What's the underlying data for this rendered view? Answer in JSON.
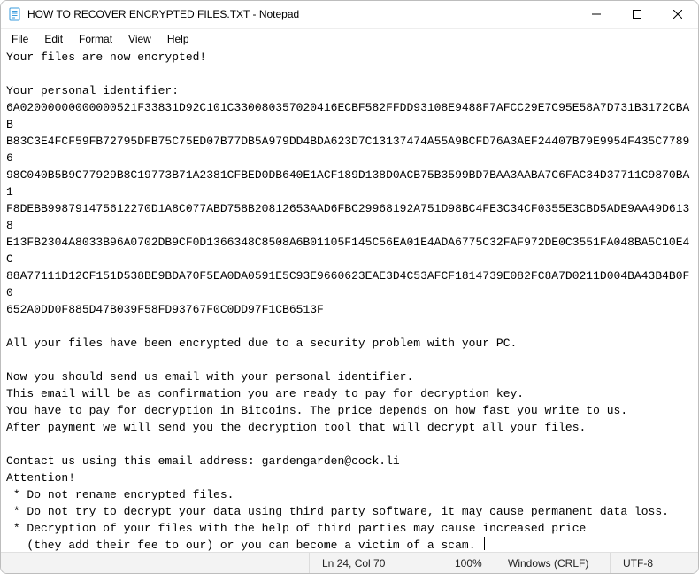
{
  "window": {
    "title": "HOW TO RECOVER ENCRYPTED FILES.TXT - Notepad"
  },
  "menubar": {
    "items": [
      "File",
      "Edit",
      "Format",
      "View",
      "Help"
    ]
  },
  "content": {
    "text": "Your files are now encrypted!\n\nYour personal identifier:\n6A02000000000000521F33831D92C101C330080357020416ECBF582FFDD93108E9488F7AFCC29E7C95E58A7D731B3172CBAB\nB83C3E4FCF59FB72795DFB75C75ED07B77DB5A979DD4BDA623D7C13137474A55A9BCFD76A3AEF24407B79E9954F435C77896\n98C040B5B9C77929B8C19773B71A2381CFBED0DB640E1ACF189D138D0ACB75B3599BD7BAA3AABA7C6FAC34D37711C9870BA1\nF8DEBB998791475612270D1A8C077ABD758B20812653AAD6FBC29968192A751D98BC4FE3C34CF0355E3CBD5ADE9AA49D6138\nE13FB2304A8033B96A0702DB9CF0D1366348C8508A6B01105F145C56EA01E4ADA6775C32FAF972DE0C3551FA048BA5C10E4C\n88A77111D12CF151D538BE9BDA70F5EA0DA0591E5C93E9660623EAE3D4C53AFCF1814739E082FC8A7D0211D004BA43B4B0F0\n652A0DD0F885D47B039F58FD93767F0C0DD97F1CB6513F\n\nAll your files have been encrypted due to a security problem with your PC.\n\nNow you should send us email with your personal identifier.\nThis email will be as confirmation you are ready to pay for decryption key.\nYou have to pay for decryption in Bitcoins. The price depends on how fast you write to us.\nAfter payment we will send you the decryption tool that will decrypt all your files.\n\nContact us using this email address: gardengarden@cock.li\nAttention!\n * Do not rename encrypted files.\n * Do not try to decrypt your data using third party software, it may cause permanent data loss.\n * Decryption of your files with the help of third parties may cause increased price\n   (they add their fee to our) or you can become a victim of a scam. "
  },
  "statusbar": {
    "position": "Ln 24, Col 70",
    "zoom": "100%",
    "eol": "Windows (CRLF)",
    "encoding": "UTF-8"
  }
}
